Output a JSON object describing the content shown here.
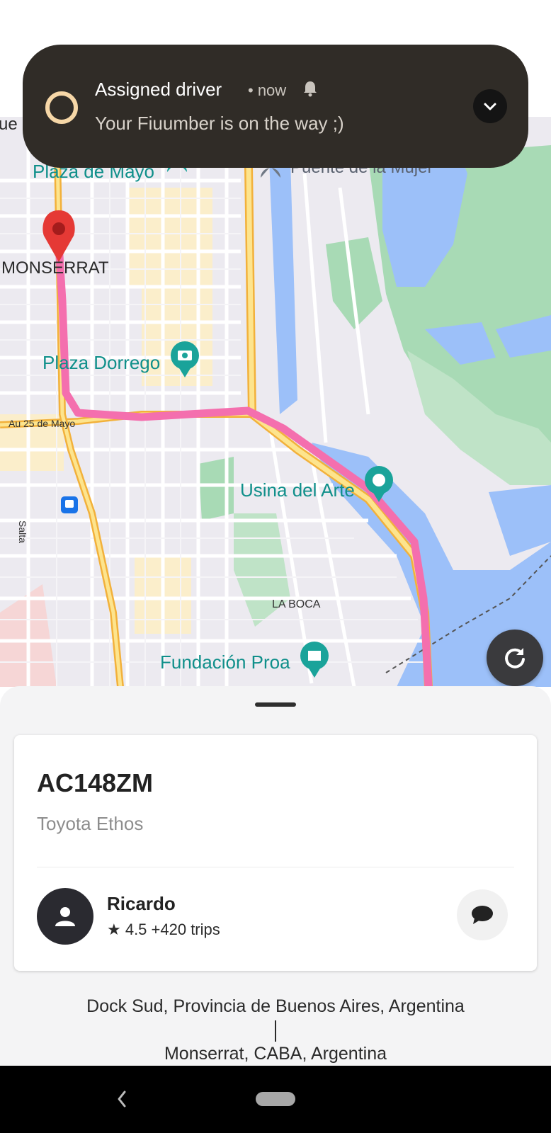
{
  "notification": {
    "title": "Assigned driver",
    "meta": "• now",
    "body": "Your Fiuumber is on the way ;)",
    "icons": [
      "status-ring-icon",
      "bell-icon",
      "chevron-down-icon"
    ]
  },
  "map": {
    "labels": {
      "plaza_de_mayo": "Plaza de Mayo",
      "puente_de_la_mujer": "Puente de la Mujer",
      "monserrat": "MONSERRAT",
      "plaza_dorrego": "Plaza Dorrego",
      "au_25_de_mayo": "Au 25 de Mayo",
      "usina_del_arte": "Usina del Arte",
      "salta": "Salta",
      "la_boca": "LA BOCA",
      "fundacion_proa": "Fundación Proa",
      "cut_label": "ue"
    },
    "route_color": "#f46fae",
    "pin_color": "#e53935"
  },
  "trip": {
    "plate": "AC148ZM",
    "car": "Toyota Ethos",
    "driver_name": "Ricardo",
    "driver_rating": "★ 4.5 +420 trips",
    "origin": "Dock Sud, Provincia de Buenos Aires, Argentina",
    "destination": "Monserrat, CABA, Argentina"
  }
}
